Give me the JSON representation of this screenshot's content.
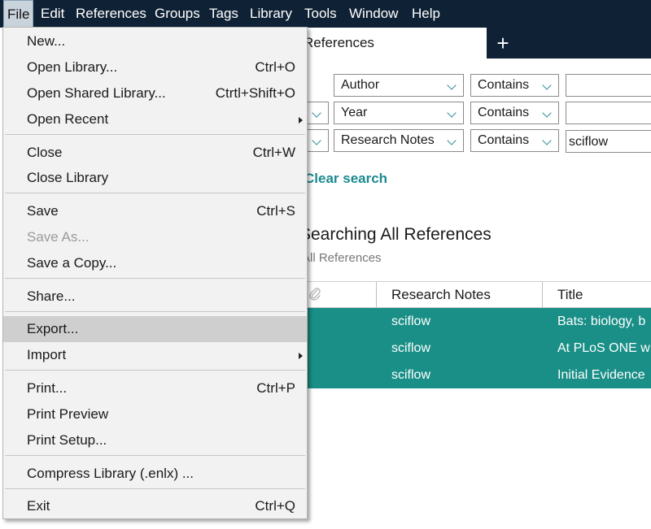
{
  "menubar": {
    "items": [
      "File",
      "Edit",
      "References",
      "Groups",
      "Tags",
      "Library",
      "Tools",
      "Window",
      "Help"
    ]
  },
  "tabs": {
    "active_label": "References",
    "add_label": "+"
  },
  "search": {
    "rows": [
      {
        "field": "Author",
        "operator": "Contains",
        "value": ""
      },
      {
        "field": "Year",
        "operator": "Contains",
        "value": ""
      },
      {
        "field": "Research Notes",
        "operator": "Contains",
        "value": "sciflow"
      }
    ],
    "clear_label": "Clear search"
  },
  "results": {
    "title": "Searching All References",
    "subtitle": "All References"
  },
  "table": {
    "columns": [
      "Research Notes",
      "Title"
    ],
    "rows": [
      {
        "notes": "sciflow",
        "title": "Bats: biology, b"
      },
      {
        "notes": "sciflow",
        "title": "At PLoS ONE w"
      },
      {
        "notes": "sciflow",
        "title": "Initial Evidence"
      }
    ],
    "selected_color": "#1a8f87"
  },
  "file_menu": {
    "items": [
      {
        "label": "New...",
        "shortcut": ""
      },
      {
        "label": "Open Library...",
        "shortcut": "Ctrl+O"
      },
      {
        "label": "Open Shared Library...",
        "shortcut": "Ctrtl+Shift+O"
      },
      {
        "label": "Open Recent",
        "shortcut": "",
        "submenu": true
      },
      {
        "label": "Close",
        "shortcut": "Ctrl+W"
      },
      {
        "label": "Close Library",
        "shortcut": ""
      },
      {
        "label": "Save",
        "shortcut": "Ctrl+S"
      },
      {
        "label": "Save As...",
        "shortcut": "",
        "disabled": true
      },
      {
        "label": "Save a Copy...",
        "shortcut": ""
      },
      {
        "label": "Share...",
        "shortcut": ""
      },
      {
        "label": "Export...",
        "shortcut": "",
        "highlighted": true
      },
      {
        "label": "Import",
        "shortcut": "",
        "submenu": true
      },
      {
        "label": "Print...",
        "shortcut": "Ctrl+P"
      },
      {
        "label": "Print Preview",
        "shortcut": ""
      },
      {
        "label": "Print Setup...",
        "shortcut": ""
      },
      {
        "label": "Compress Library (.enlx) ...",
        "shortcut": ""
      },
      {
        "label": "Exit",
        "shortcut": "Ctrl+Q"
      }
    ]
  },
  "colors": {
    "menubar_bg": "#0f2235",
    "accent": "#1b8a8f",
    "menu_highlight": "#cfcfcf"
  }
}
